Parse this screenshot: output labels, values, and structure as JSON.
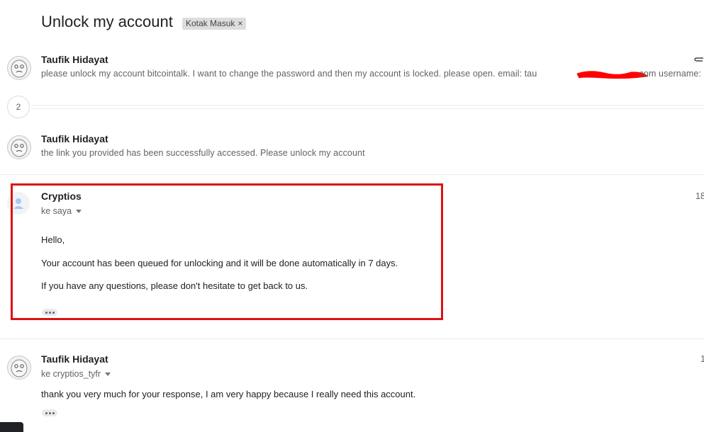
{
  "thread": {
    "subject": "Unlock my account",
    "label": "Kotak Masuk",
    "label_remove": "×",
    "collapsed_count": "2"
  },
  "messages": [
    {
      "sender": "Taufik Hidayat",
      "snippet_before": "please unlock my account bitcointalk. I want to change the password and then my account is locked. please open. email: tau",
      "snippet_after": ".com username:"
    },
    {
      "sender": "Taufik Hidayat",
      "snippet": "the link you provided has been successfully accessed. Please unlock my account"
    },
    {
      "sender": "Cryptios",
      "to": "ke saya",
      "time": "18",
      "body": [
        "Hello,",
        "Your account has been queued for unlocking and it will be done automatically in 7 days.",
        "If you have any questions, please don't hesitate to get back to us."
      ]
    },
    {
      "sender": "Taufik Hidayat",
      "to": "ke cryptios_tyfr",
      "time": "1",
      "body": "thank you very much for your response, I am very happy because I really need this account."
    }
  ],
  "colors": {
    "highlight_box": "#dd1111",
    "redaction": "#ff0000"
  }
}
